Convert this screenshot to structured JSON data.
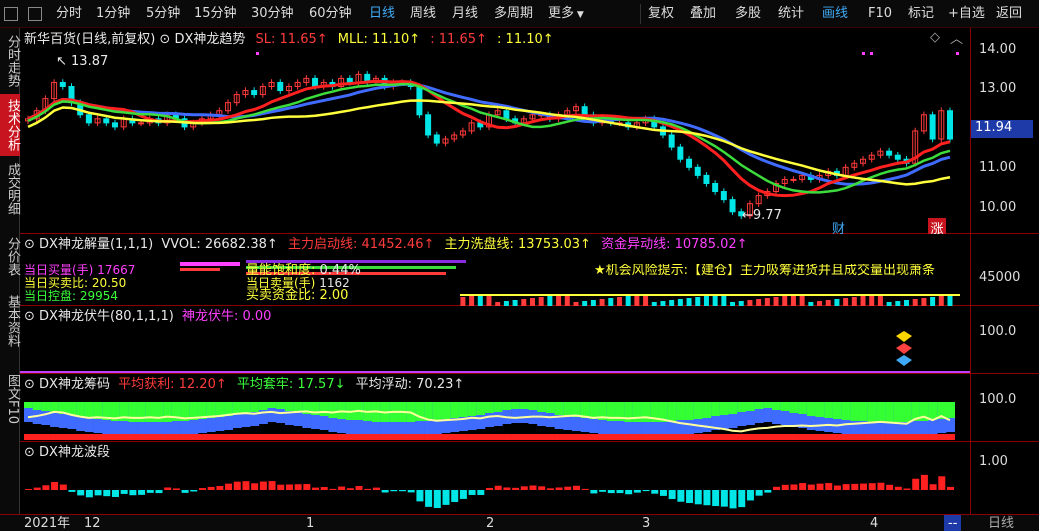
{
  "toolbar": {
    "items": [
      "分时",
      "1分钟",
      "5分钟",
      "15分钟",
      "30分钟",
      "60分钟",
      "日线",
      "周线",
      "月线",
      "多周期",
      "更多",
      "复权",
      "叠加",
      "多股",
      "统计",
      "画线",
      "F10",
      "标记",
      "+自选",
      "返回"
    ],
    "active": "日线"
  },
  "left_tabs": [
    "分时走势",
    "技术分析",
    "成交明细",
    "分价表",
    "基本资料",
    "图文F10"
  ],
  "left_active": "技术分析",
  "main": {
    "title": "新华百货(日线,前复权)",
    "indicator": "DX神龙趋势",
    "sl": "SL: 11.65↑",
    "mll": "MLL: 11.10↑",
    "v3": ": 11.65↑",
    "v4": ": 11.10↑",
    "high_label": "13.87",
    "low_label": "9.77",
    "marker_cai": "财",
    "marker_zhang": "涨",
    "axis": [
      "14.00",
      "13.00",
      "12.00",
      "11.00",
      "10.00"
    ],
    "current_price": "11.94"
  },
  "vol": {
    "title": "DX神龙解量(1,1,1)",
    "vvol": "VVOL: 26682.38↑",
    "zhuli_qidong": "主力启动线: 41452.46↑",
    "zhuli_xipan": "主力洗盘线: 13753.03↑",
    "zijin": "资金异动线: 10785.02↑",
    "overlay_1": "当日买量(手) 17667",
    "overlay_2": "量能饱和度:",
    "overlay_2v": "0.44%",
    "overlay_3": "当日卖量(手)",
    "overlay_3v": "1162",
    "overlay_4": "当日买卖比: 20.50",
    "overlay_5": "买卖资金比: 2.00",
    "overlay_6": "当日控盘: 29954",
    "risk": "★机会风险提示:【建仓】主力吸筹进货并且成交量出现萧条",
    "axis": [
      "45000"
    ]
  },
  "fuju": {
    "title": "DX神龙伏牛(80,1,1,1)",
    "value": "神龙伏牛: 0.00",
    "axis": [
      "100.0"
    ]
  },
  "chouma": {
    "title": "DX神龙筹码",
    "pjhl": "平均获利: 12.20↑",
    "pjtl": "平均套牢: 17.57↓",
    "pjfd": "平均浮动: 70.23↑",
    "axis": [
      "100.0"
    ]
  },
  "boduan": {
    "title": "DX神龙波段",
    "axis": [
      "1.00"
    ]
  },
  "dates": [
    "2021年",
    "12",
    "1",
    "2",
    "3",
    "4",
    "--"
  ],
  "bottom_right": "日线",
  "chart_data": {
    "type": "line",
    "title": "新华百货(日线,前复权)",
    "ylim": [
      9.5,
      14.4
    ],
    "close": [
      12.4,
      12.6,
      12.9,
      13.3,
      13.2,
      12.8,
      12.5,
      12.3,
      12.4,
      12.3,
      12.2,
      12.4,
      12.3,
      12.3,
      12.4,
      12.3,
      12.5,
      12.4,
      12.2,
      12.3,
      12.4,
      12.5,
      12.6,
      12.8,
      13.0,
      13.1,
      13.0,
      13.2,
      13.3,
      13.1,
      13.2,
      13.3,
      13.4,
      13.2,
      13.3,
      13.2,
      13.4,
      13.3,
      13.5,
      13.3,
      13.4,
      13.2,
      13.3,
      13.3,
      13.2,
      12.5,
      12.0,
      11.8,
      11.9,
      12.0,
      12.1,
      12.3,
      12.2,
      12.5,
      12.6,
      12.4,
      12.3,
      12.4,
      12.5,
      12.5,
      12.4,
      12.5,
      12.6,
      12.7,
      12.5,
      12.3,
      12.4,
      12.3,
      12.3,
      12.2,
      12.3,
      12.4,
      12.2,
      12.0,
      11.7,
      11.4,
      11.2,
      11.0,
      10.8,
      10.6,
      10.4,
      10.1,
      10.0,
      10.3,
      10.5,
      10.6,
      10.8,
      10.9,
      10.9,
      11.0,
      10.9,
      11.0,
      11.1,
      11.0,
      11.2,
      11.3,
      11.4,
      11.5,
      11.6,
      11.5,
      11.4,
      11.3,
      12.1,
      12.5,
      11.9,
      12.6,
      11.9
    ],
    "sl_last": 11.65,
    "mll_last": 11.1,
    "high": 13.87,
    "low": 9.77,
    "last": 11.94
  }
}
